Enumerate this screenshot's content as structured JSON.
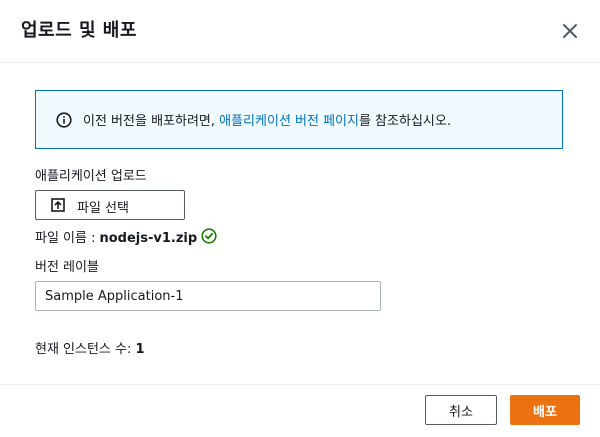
{
  "dialog": {
    "title": "업로드 및 배포"
  },
  "alert": {
    "text_before": "이전 버전을 배포하려면, ",
    "link_text": "애플리케이션 버전 페이지",
    "text_after": "를 참조하십시오."
  },
  "upload": {
    "label": "애플리케이션 업로드",
    "choose_button": "파일 선택",
    "filename_label": "파일 이름 :",
    "filename_value": "nodejs-v1.zip"
  },
  "version": {
    "label": "버전 레이블",
    "value": "Sample Application-1"
  },
  "instances": {
    "label": "현재 인스턴스 수:",
    "count": "1"
  },
  "footer": {
    "cancel_label": "취소",
    "deploy_label": "배포"
  },
  "colors": {
    "accent": "#ec7211",
    "link": "#0073bb",
    "success": "#1d8102",
    "info_border": "#0073bb"
  },
  "icons": {
    "close": "close-icon",
    "info": "info-icon",
    "upload": "upload-icon",
    "check": "check-circle-icon"
  }
}
